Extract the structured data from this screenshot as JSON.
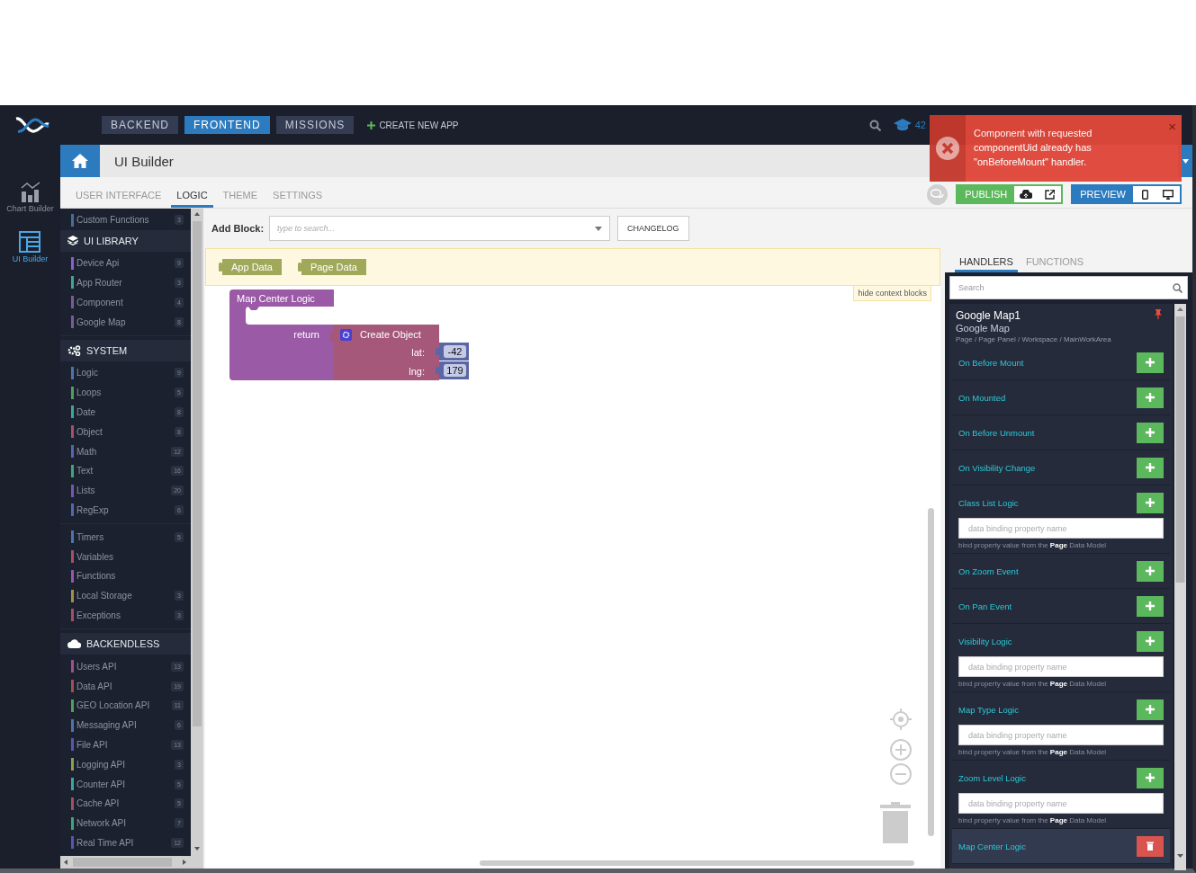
{
  "top_nav": {
    "buttons": [
      {
        "label": "BACKEND",
        "selected": false
      },
      {
        "label": "FRONTEND",
        "selected": true
      },
      {
        "label": "MISSIONS",
        "selected": false
      }
    ],
    "create_app": "CREATE NEW APP",
    "points": "42"
  },
  "rail": [
    {
      "label": "Chart Builder",
      "selected": false,
      "kind": "chart"
    },
    {
      "label": "UI Builder",
      "selected": true,
      "kind": "layout"
    }
  ],
  "header": {
    "title": "UI Builder"
  },
  "builder_tabs": [
    {
      "label": "USER INTERFACE",
      "selected": false
    },
    {
      "label": "LOGIC",
      "selected": true
    },
    {
      "label": "THEME",
      "selected": false
    },
    {
      "label": "SETTINGS",
      "selected": false
    }
  ],
  "actions": {
    "publish": "PUBLISH",
    "preview": "PREVIEW"
  },
  "toast": {
    "message": "Component with requested componentUid already has \"onBeforeMount\" handler.",
    "close": "×"
  },
  "sidebar": {
    "top_items": [
      {
        "label": "Custom Functions",
        "count": "3",
        "color": "#4a6d9c"
      }
    ],
    "sections": [
      {
        "title": "UI LIBRARY",
        "kind": "library",
        "groups": [
          {
            "items": [
              {
                "label": "Device Api",
                "count": "9",
                "color": "#8a5fd0"
              },
              {
                "label": "App Router",
                "count": "3",
                "color": "#3fa59a"
              },
              {
                "label": "Component",
                "count": "4",
                "color": "#7b5a9c"
              },
              {
                "label": "Google Map",
                "count": "8",
                "color": "#7b5a9c"
              }
            ]
          }
        ]
      },
      {
        "title": "SYSTEM",
        "kind": "system",
        "groups": [
          {
            "items": [
              {
                "label": "Logic",
                "count": "9",
                "color": "#4f74a8"
              },
              {
                "label": "Loops",
                "count": "5",
                "color": "#4fa05a"
              },
              {
                "label": "Date",
                "count": "8",
                "color": "#3fa59a"
              },
              {
                "label": "Object",
                "count": "8",
                "color": "#a55068"
              },
              {
                "label": "Math",
                "count": "12",
                "color": "#5566b0"
              },
              {
                "label": "Text",
                "count": "16",
                "color": "#3fa579"
              },
              {
                "label": "Lists",
                "count": "20",
                "color": "#7a55b0"
              },
              {
                "label": "RegExp",
                "count": "6",
                "color": "#5566b0"
              }
            ]
          },
          {
            "items": [
              {
                "label": "Timers",
                "count": "5",
                "color": "#4f74a8"
              },
              {
                "label": "Variables",
                "color": "#a55068"
              },
              {
                "label": "Functions",
                "color": "#9b55a8"
              },
              {
                "label": "Local Storage",
                "count": "3",
                "color": "#a5904a"
              },
              {
                "label": "Exceptions",
                "count": "3",
                "color": "#a55060"
              }
            ]
          }
        ]
      },
      {
        "title": "BACKENDLESS",
        "kind": "cloud",
        "groups": [
          {
            "items": [
              {
                "label": "Users API",
                "count": "13",
                "color": "#a0508a"
              },
              {
                "label": "Data API",
                "count": "19",
                "color": "#a05050"
              },
              {
                "label": "GEO Location API",
                "count": "11",
                "color": "#4fa05a"
              },
              {
                "label": "Messaging API",
                "count": "6",
                "color": "#4f74a8"
              },
              {
                "label": "File API",
                "count": "13",
                "color": "#5a55b0"
              },
              {
                "label": "Logging API",
                "count": "3",
                "color": "#90a04a"
              },
              {
                "label": "Counter API",
                "count": "5",
                "color": "#3fa59a"
              },
              {
                "label": "Cache API",
                "count": "5",
                "color": "#a55060"
              },
              {
                "label": "Network API",
                "count": "7",
                "color": "#3fa579"
              },
              {
                "label": "Real Time API",
                "count": "12",
                "color": "#5a55b0"
              }
            ]
          }
        ]
      }
    ]
  },
  "logic": {
    "add_block_label": "Add Block:",
    "search_placeholder": "type to search...",
    "changelog": "CHANGELOG",
    "context_blocks": [
      "App Data",
      "Page Data"
    ],
    "hide_context": "hide context blocks",
    "block": {
      "title": "Map Center Logic",
      "return_label": "return",
      "object_title": "Create Object",
      "fields": [
        {
          "name": "lat:",
          "value": "-42"
        },
        {
          "name": "lng:",
          "value": "179"
        }
      ]
    }
  },
  "handlers_panel": {
    "tabs": [
      {
        "label": "HANDLERS",
        "selected": true
      },
      {
        "label": "FUNCTIONS",
        "selected": false
      }
    ],
    "search_placeholder": "Search",
    "component": {
      "name": "Google Map1",
      "type": "Google Map",
      "path": "Page / Page Panel / Workspace / MainWorkArea",
      "pinned": true
    },
    "handlers": [
      {
        "label": "On Before Mount",
        "kind": "event",
        "defined": false,
        "selected": false
      },
      {
        "label": "On Mounted",
        "kind": "event",
        "defined": false,
        "selected": false
      },
      {
        "label": "On Before Unmount",
        "kind": "event",
        "defined": false,
        "selected": false
      },
      {
        "label": "On Visibility Change",
        "kind": "event",
        "defined": false,
        "selected": false
      },
      {
        "label": "Class List Logic",
        "kind": "binding",
        "defined": false,
        "selected": false,
        "placeholder": "data binding property name",
        "hint": "bind property value from the **Page** Data Model"
      },
      {
        "label": "On Zoom Event",
        "kind": "event",
        "defined": false,
        "selected": false
      },
      {
        "label": "On Pan Event",
        "kind": "event",
        "defined": false,
        "selected": false
      },
      {
        "label": "Visibility Logic",
        "kind": "binding",
        "defined": false,
        "selected": false,
        "placeholder": "data binding property name",
        "hint": "bind property value from the **Page** Data Model"
      },
      {
        "label": "Map Type Logic",
        "kind": "binding",
        "defined": false,
        "selected": false,
        "placeholder": "data binding property name",
        "hint": "bind property value from the **Page** Data Model"
      },
      {
        "label": "Zoom Level Logic",
        "kind": "binding",
        "defined": false,
        "selected": false,
        "placeholder": "data binding property name",
        "hint": "bind property value from the **Page** Data Model"
      },
      {
        "label": "Map Center Logic",
        "kind": "event",
        "defined": true,
        "selected": true
      }
    ]
  }
}
